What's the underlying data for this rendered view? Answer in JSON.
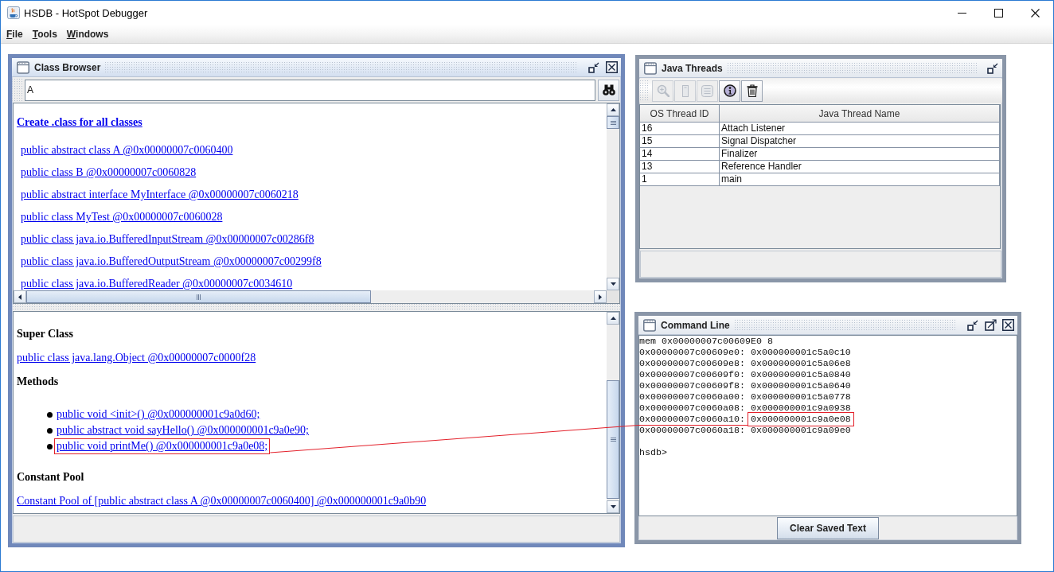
{
  "window": {
    "title": "HSDB - HotSpot Debugger"
  },
  "menu": [
    "File",
    "Tools",
    "Windows"
  ],
  "class_browser": {
    "title": "Class Browser",
    "active": true,
    "controls": [
      {
        "kind": "iconify"
      },
      {
        "kind": "close"
      }
    ],
    "search": {
      "value": "A"
    },
    "create_link": "Create .class for all classes",
    "classes": [
      "public abstract class A @0x00000007c0060400",
      "public class B @0x00000007c0060828",
      "public abstract interface MyInterface @0x00000007c0060218",
      "public class MyTest @0x00000007c0060028",
      "public class java.io.BufferedInputStream @0x00000007c00286f8",
      "public class java.io.BufferedOutputStream @0x00000007c00299f8",
      "public class java.io.BufferedReader @0x00000007c0034610"
    ],
    "super_class_heading": "Super Class",
    "super_class": "public class java.lang.Object @0x00000007c0000f28",
    "methods_heading": "Methods",
    "methods": [
      {
        "text": "public void <init>() @0x000000001c9a0d60;",
        "highlighted": false
      },
      {
        "text": "public abstract void sayHello() @0x000000001c9a0e90;",
        "highlighted": false
      },
      {
        "text": "public void printMe() @0x000000001c9a0e08;",
        "highlighted": true
      }
    ],
    "constant_pool_heading": "Constant Pool",
    "constant_pool": "Constant Pool of [public abstract class A @0x00000007c0060400] @0x000000001c9a0b90"
  },
  "java_threads": {
    "title": "Java Threads",
    "active": false,
    "controls": [
      {
        "kind": "iconify"
      }
    ],
    "toolbar": [
      {
        "kind": "magnifier",
        "disabled": true
      },
      {
        "kind": "page",
        "disabled": true
      },
      {
        "kind": "note",
        "disabled": true
      },
      {
        "kind": "info",
        "disabled": false
      },
      {
        "kind": "trash",
        "disabled": false
      }
    ],
    "table": {
      "columns": [
        "OS Thread ID",
        "Java Thread Name"
      ],
      "rows": [
        {
          "cells": [
            "16",
            "Attach Listener"
          ],
          "selected": false
        },
        {
          "cells": [
            "15",
            "Signal Dispatcher"
          ],
          "selected": false
        },
        {
          "cells": [
            "14",
            "Finalizer"
          ],
          "selected": false
        },
        {
          "cells": [
            "13",
            "Reference Handler"
          ],
          "selected": false
        },
        {
          "cells": [
            "1",
            "main"
          ],
          "selected": false
        }
      ]
    }
  },
  "command_line": {
    "title": "Command Line",
    "active": false,
    "controls": [
      {
        "kind": "iconify"
      },
      {
        "kind": "maximize"
      },
      {
        "kind": "close"
      }
    ],
    "command": "mem 0x00000007c00609E0 8",
    "output": [
      {
        "address": "0x00000007c00609e0:",
        "value": "0x000000001c5a0c10",
        "highlighted": false
      },
      {
        "address": "0x00000007c00609e8:",
        "value": "0x000000001c5a06e8",
        "highlighted": false
      },
      {
        "address": "0x00000007c00609f0:",
        "value": "0x000000001c5a0840",
        "highlighted": false
      },
      {
        "address": "0x00000007c00609f8:",
        "value": "0x000000001c5a0640",
        "highlighted": false
      },
      {
        "address": "0x00000007c0060a00:",
        "value": "0x000000001c5a0778",
        "highlighted": false
      },
      {
        "address": "0x00000007c0060a08:",
        "value": "0x000000001c9a0938",
        "highlighted": false
      },
      {
        "address": "0x00000007c0060a10:",
        "value": "0x000000001c9a0e08",
        "highlighted": true
      },
      {
        "address": "0x00000007c0060a18:",
        "value": "0x000000001c9a09e0",
        "highlighted": false
      }
    ],
    "prompt": "hsdb>",
    "button": "Clear Saved Text"
  }
}
